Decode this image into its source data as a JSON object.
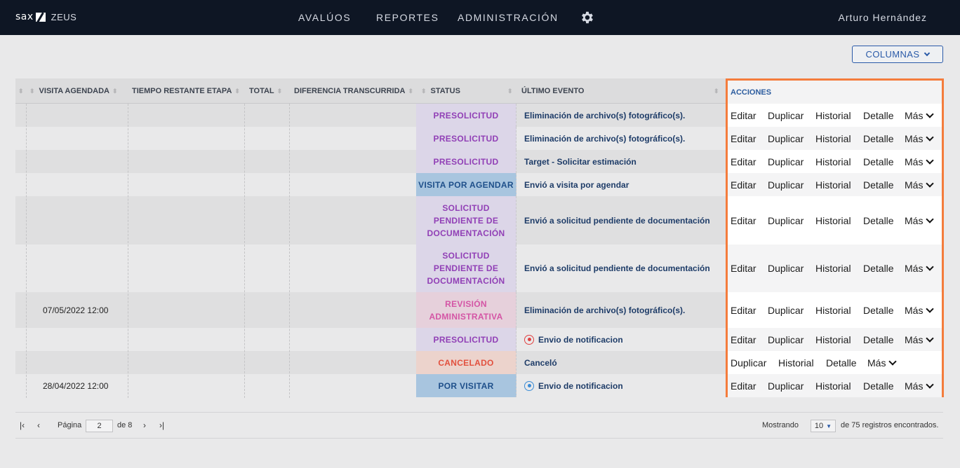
{
  "header": {
    "brand": "sax",
    "app_name": "ZEUS",
    "nav": [
      "AVALÚOS",
      "REPORTES",
      "ADMINISTRACIÓN"
    ],
    "user": "Arturo Hernández"
  },
  "toolbar": {
    "columns_label": "COLUMNAS"
  },
  "table": {
    "headers": {
      "visita": "VISITA AGENDADA",
      "tiempo": "TIEMPO RESTANTE ETAPA",
      "total": "TOTAL",
      "diferencia": "DIFERENCIA TRANSCURRIDA",
      "status": "STATUS",
      "evento": "ÚLTIMO EVENTO",
      "acciones": "ACCIONES"
    },
    "rows": [
      {
        "visita": "",
        "status": "PRESOLICITUD",
        "event": "Eliminación de archivo(s) fotográfico(s)."
      },
      {
        "visita": "",
        "status": "PRESOLICITUD",
        "event": "Eliminación de archivo(s) fotográfico(s)."
      },
      {
        "visita": "",
        "status": "PRESOLICITUD",
        "event": "Target - Solicitar estimación"
      },
      {
        "visita": "",
        "status": "VISITA POR AGENDAR",
        "event": "Envió a visita por agendar"
      },
      {
        "visita": "",
        "status": "SOLICITUD PENDIENTE DE DOCUMENTACIÓN",
        "event": "Envió a solicitud pendiente de documentación"
      },
      {
        "visita": "",
        "status": "SOLICITUD PENDIENTE DE DOCUMENTACIÓN",
        "event": "Envió a solicitud pendiente de documentación"
      },
      {
        "visita": "07/05/2022 12:00",
        "status": "REVISIÓN ADMINISTRATIVA",
        "event": "Eliminación de archivo(s) fotográfico(s)."
      },
      {
        "visita": "",
        "status": "PRESOLICITUD",
        "event": "Envio de notificacion"
      },
      {
        "visita": "",
        "status": "CANCELADO",
        "event": "Canceló"
      },
      {
        "visita": "28/04/2022 12:00",
        "status": "POR VISITAR",
        "event": "Envio de notificacion"
      }
    ],
    "actions": {
      "edit": "Editar",
      "duplicate": "Duplicar",
      "history": "Historial",
      "detail": "Detalle",
      "more": "Más"
    }
  },
  "pagination": {
    "page_label": "Página",
    "page": "2",
    "of_label": "de 8",
    "showing_label": "Mostrando",
    "page_size": "10",
    "records_label": "de 75 registros encontrados."
  },
  "colors": {
    "topbar": "#0e1624",
    "highlight": "#f47c3c",
    "accent": "#2a5aa8"
  }
}
